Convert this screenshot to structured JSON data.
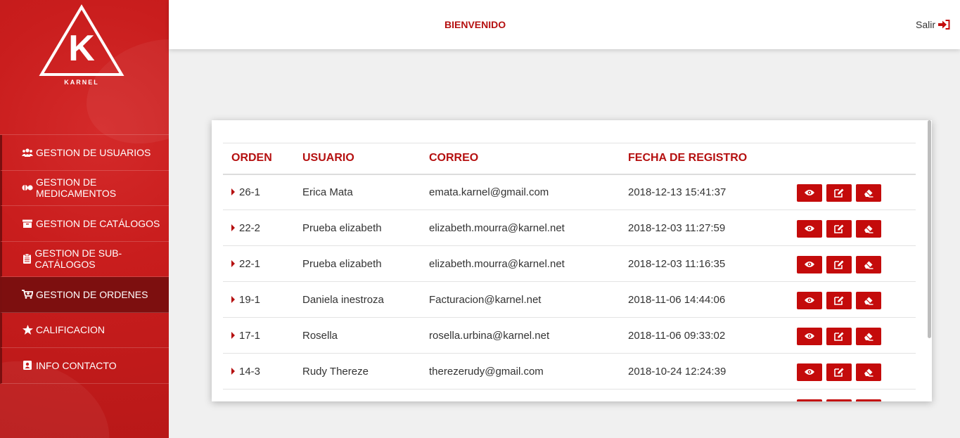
{
  "brand": {
    "logo_letter": "K",
    "logo_text": "KARNEL"
  },
  "sidebar": {
    "items": [
      {
        "label": "GESTION DE USUARIOS",
        "icon": "users-icon",
        "active": false
      },
      {
        "label": "GESTION DE MEDICAMENTOS",
        "icon": "pills-icon",
        "active": false
      },
      {
        "label": "GESTION DE CATÁLOGOS",
        "icon": "archive-icon",
        "active": false
      },
      {
        "label": "GESTION DE SUB-CATÁLOGOS",
        "icon": "clipboard-icon",
        "active": false
      },
      {
        "label": "GESTION DE ORDENES",
        "icon": "cart-icon",
        "active": true
      },
      {
        "label": "CALIFICACION",
        "icon": "star-icon",
        "active": false
      },
      {
        "label": "INFO CONTACTO",
        "icon": "contact-card-icon",
        "active": false
      }
    ]
  },
  "header": {
    "title": "BIENVENIDO",
    "logout_label": "Salir",
    "logout_icon": "sign-out-icon"
  },
  "table": {
    "columns": [
      "ORDEN",
      "USUARIO",
      "CORREO",
      "FECHA DE REGISTRO"
    ],
    "rows": [
      {
        "orden": "26-1",
        "usuario": "Erica Mata",
        "correo": "emata.karnel@gmail.com",
        "fecha": "2018-12-13 15:41:37"
      },
      {
        "orden": "22-2",
        "usuario": "Prueba elizabeth",
        "correo": "elizabeth.mourra@karnel.net",
        "fecha": "2018-12-03 11:27:59"
      },
      {
        "orden": "22-1",
        "usuario": "Prueba elizabeth",
        "correo": "elizabeth.mourra@karnel.net",
        "fecha": "2018-12-03 11:16:35"
      },
      {
        "orden": "19-1",
        "usuario": "Daniela inestroza",
        "correo": "Facturacion@karnel.net",
        "fecha": "2018-11-06 14:44:06"
      },
      {
        "orden": "17-1",
        "usuario": "Rosella",
        "correo": "rosella.urbina@karnel.net",
        "fecha": "2018-11-06 09:33:02"
      },
      {
        "orden": "14-3",
        "usuario": "Rudy Thereze",
        "correo": "therezerudy@gmail.com",
        "fecha": "2018-10-24 12:24:39"
      }
    ],
    "action_icons": [
      "eye-icon",
      "edit-icon",
      "eraser-icon"
    ]
  },
  "colors": {
    "primary_red": "#c91d1d",
    "active_menu": "#7d0f0f",
    "accent_text": "#b51010",
    "button_red": "#c40b0b"
  }
}
